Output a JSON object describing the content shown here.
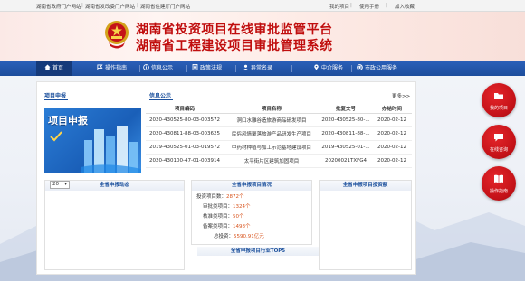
{
  "topbar": {
    "left_links": [
      "湖南省政府门户网站",
      "湖南省发改委门户网站",
      "湖南省住建厅门户网站"
    ],
    "right_links": [
      "我的项目",
      "使用手册",
      "加入收藏"
    ]
  },
  "header": {
    "title_line1": "湖南省投资项目在线审批监管平台",
    "title_line2": "湖南省工程建设项目审批管理系统"
  },
  "nav": {
    "items": [
      {
        "label": "首页",
        "icon": "home-icon"
      },
      {
        "label": "操作指南",
        "icon": "flag-icon"
      },
      {
        "label": "信息公示",
        "icon": "info-icon"
      },
      {
        "label": "政策法规",
        "icon": "doc-icon"
      },
      {
        "label": "异常名录",
        "icon": "user-icon"
      },
      {
        "label": "中介服务",
        "icon": "map-pin-icon"
      },
      {
        "label": "市政公用服务",
        "icon": "city-icon"
      }
    ]
  },
  "project_apply": {
    "title": "项目申报",
    "banner_text": "项目申报"
  },
  "info_notice": {
    "title": "信息公示",
    "more": "更多>>",
    "columns": [
      "项目编码",
      "项目名称",
      "批复文号",
      "办结时间"
    ],
    "rows": [
      [
        "2020-430525-80-03-003572",
        "洞口水雕谷造旅游商品研发项目",
        "2020-430525-80-...",
        "2020-02-12"
      ],
      [
        "2020-430811-88-03-003625",
        "民俗风情聚落旅游产品研发生产项目",
        "2020-430811-88-...",
        "2020-02-12"
      ],
      [
        "2019-430525-01-03-019572",
        "中药材种植与加工示范基地建设项目",
        "2019-430525-01-...",
        "2020-02-12"
      ],
      [
        "2020-430100-47-01-003914",
        "太平街片区建筑加固项目",
        "20200021TXFG4",
        "2020-02-12"
      ]
    ]
  },
  "dynamic_panel": {
    "title": "全省申报动态",
    "select_value": "20"
  },
  "stats_panel": {
    "title": "全省申报项目情况",
    "items": [
      {
        "label": "投资项目数：",
        "value": "2872个"
      },
      {
        "label": "审批类项目：",
        "value": "1324个"
      },
      {
        "label": "核准类项目：",
        "value": "50个"
      },
      {
        "label": "备案类项目：",
        "value": "1498个"
      },
      {
        "label": "总投资：",
        "value": "5590.91亿元"
      }
    ],
    "top5": "全省申报项目行业TOP5"
  },
  "invest_panel": {
    "title": "全省申报项目投资额"
  },
  "side_buttons": [
    {
      "label": "我的项目",
      "icon": "folder-icon"
    },
    {
      "label": "在线咨询",
      "icon": "chat-icon"
    },
    {
      "label": "操作指南",
      "icon": "book-icon"
    }
  ],
  "colors": {
    "brand_red": "#c00e0e",
    "nav_blue": "#1d4d9c",
    "accent_orange": "#d8531c"
  }
}
